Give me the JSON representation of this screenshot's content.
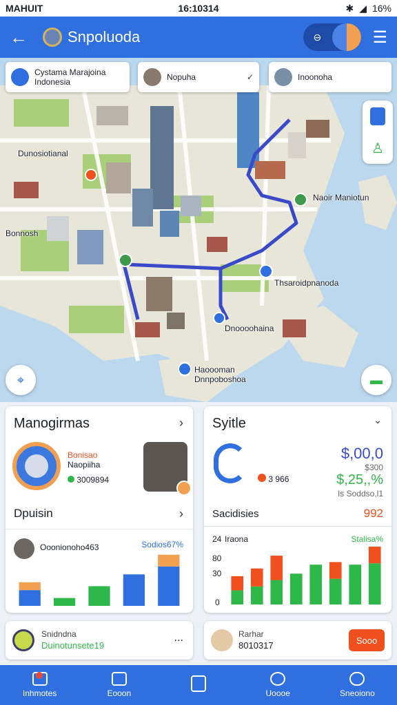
{
  "status_bar": {
    "carrier": "MAHUIT",
    "time": "16:10314",
    "battery": "16%"
  },
  "app_bar": {
    "title": "Snpoluoda"
  },
  "map": {
    "chips": [
      {
        "label": "Cystama Marajoina Indonesia"
      },
      {
        "label": "Nopuha"
      },
      {
        "label": "Inoonoha"
      }
    ],
    "labels": {
      "top_left": "Dunosiotianal",
      "left": "Bonnosh",
      "right_top": "Naoir Maniotun",
      "right_mid": "Thsaroidpnanoda",
      "center_low": "Dnoooohaina",
      "bottom": "Haoooman Dnnpoboshoa"
    }
  },
  "card_left": {
    "title": "Manogirmas",
    "person_line1": "Bonisao",
    "person_line2": "Naopiiha",
    "person_stat": "3009894",
    "section2_title": "Dpuisin",
    "row_name": "Ooonionoho463",
    "row_value": "Sodios67%",
    "chart_data": {
      "type": "bar",
      "title": "",
      "categories": [
        "1",
        "2",
        "3",
        "4",
        "5"
      ],
      "series": [
        {
          "name": "",
          "values": [
            2,
            0,
            0,
            4,
            5
          ],
          "color": "#2f6fe0"
        },
        {
          "name": "",
          "values": [
            1,
            0,
            0,
            0,
            1.5
          ],
          "color": "#f0a050"
        },
        {
          "name": "",
          "values": [
            0,
            1,
            2.5,
            0,
            0
          ],
          "color": "#2fb84a"
        }
      ]
    }
  },
  "card_right": {
    "title": "Syitle",
    "price": "$,00,0",
    "sub_price": "$300",
    "stat_value": "3 966",
    "percent": "$,25,,%",
    "percent_sub": "Is Soddso,l1",
    "section2_title": "Sacidisies",
    "section2_value": "992",
    "legend_left": "Iraona",
    "legend_right": "Stalisa%",
    "tick_top": "24",
    "tick_mid1": "80",
    "tick_mid2": "30",
    "tick_bottom": "0",
    "chart_data": {
      "type": "bar",
      "title": "",
      "ylabel": "",
      "ylim": [
        0,
        90
      ],
      "categories": [
        "1",
        "2",
        "3",
        "4",
        "5",
        "6",
        "7",
        "8"
      ],
      "series": [
        {
          "name": "",
          "values": [
            22,
            28,
            38,
            48,
            62,
            40,
            62,
            64
          ],
          "color": "#2fb84a"
        },
        {
          "name": "",
          "values": [
            22,
            28,
            38,
            0,
            0,
            26,
            0,
            26
          ],
          "color": "#f0501e"
        }
      ]
    }
  },
  "card_bottom_left": {
    "line1": "Snidndna",
    "line2": "Duinotunsete19",
    "more": "..."
  },
  "card_bottom_right": {
    "line1": "Rarhar",
    "line2": "8010317",
    "button": "Sooo"
  },
  "bottom_nav": [
    {
      "label": "Inhmotes"
    },
    {
      "label": "Eooon"
    },
    {
      "label": ""
    },
    {
      "label": "Uoooe"
    },
    {
      "label": "Sneoiono"
    }
  ],
  "colors": {
    "primary": "#2f6fe0",
    "accent": "#f0501e",
    "green": "#2fb84a"
  }
}
